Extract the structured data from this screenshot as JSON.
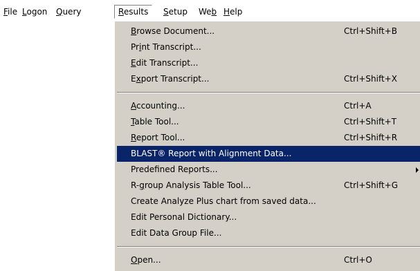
{
  "menubar": {
    "file": {
      "pre": "",
      "key": "F",
      "post": "ile"
    },
    "logon": {
      "pre": "",
      "key": "L",
      "post": "ogon"
    },
    "query": {
      "pre": "",
      "key": "Q",
      "post": "uery"
    },
    "results": {
      "pre": "",
      "key": "R",
      "post": "esults"
    },
    "setup": {
      "pre": "",
      "key": "S",
      "post": "etup"
    },
    "web": {
      "pre": "We",
      "key": "b",
      "post": ""
    },
    "help": {
      "pre": "",
      "key": "H",
      "post": "elp"
    }
  },
  "results_menu": {
    "browse_document": {
      "pre": "",
      "key": "B",
      "post": "rowse Document...",
      "shortcut": "Ctrl+Shift+B"
    },
    "print_transcript": {
      "pre": "Pr",
      "key": "i",
      "post": "nt Transcript..."
    },
    "edit_transcript": {
      "pre": "",
      "key": "E",
      "post": "dit Transcript..."
    },
    "export_transcript": {
      "pre": "E",
      "key": "x",
      "post": "port Transcript...",
      "shortcut": "Ctrl+Shift+X"
    },
    "accounting": {
      "pre": "",
      "key": "A",
      "post": "ccounting...",
      "shortcut": "Ctrl+A"
    },
    "table_tool": {
      "pre": "",
      "key": "T",
      "post": "able Tool...",
      "shortcut": "Ctrl+Shift+T"
    },
    "report_tool": {
      "pre": "",
      "key": "R",
      "post": "eport Tool...",
      "shortcut": "Ctrl+Shift+R"
    },
    "blast_report": {
      "label": "BLAST® Report with Alignment Data..."
    },
    "predefined_reports": {
      "label": "Predefined Reports..."
    },
    "rgroup_analysis": {
      "pre": "R-",
      "key": "g",
      "post": "roup Analysis Table Tool...",
      "shortcut": "Ctrl+Shift+G"
    },
    "analyze_plus_chart": {
      "label": "Create Analyze Plus chart from saved data..."
    },
    "edit_personal_dictionary": {
      "label": "Edit Personal Dictionary..."
    },
    "edit_data_group_file": {
      "label": "Edit Data Group File..."
    },
    "open": {
      "pre": "",
      "key": "O",
      "post": "pen...",
      "shortcut": "Ctrl+O"
    }
  },
  "highlighted_item": "blast_report",
  "colors": {
    "menu_background": "#d4d0c8",
    "highlight": "#0a246a",
    "highlight_text": "#ffffff"
  }
}
